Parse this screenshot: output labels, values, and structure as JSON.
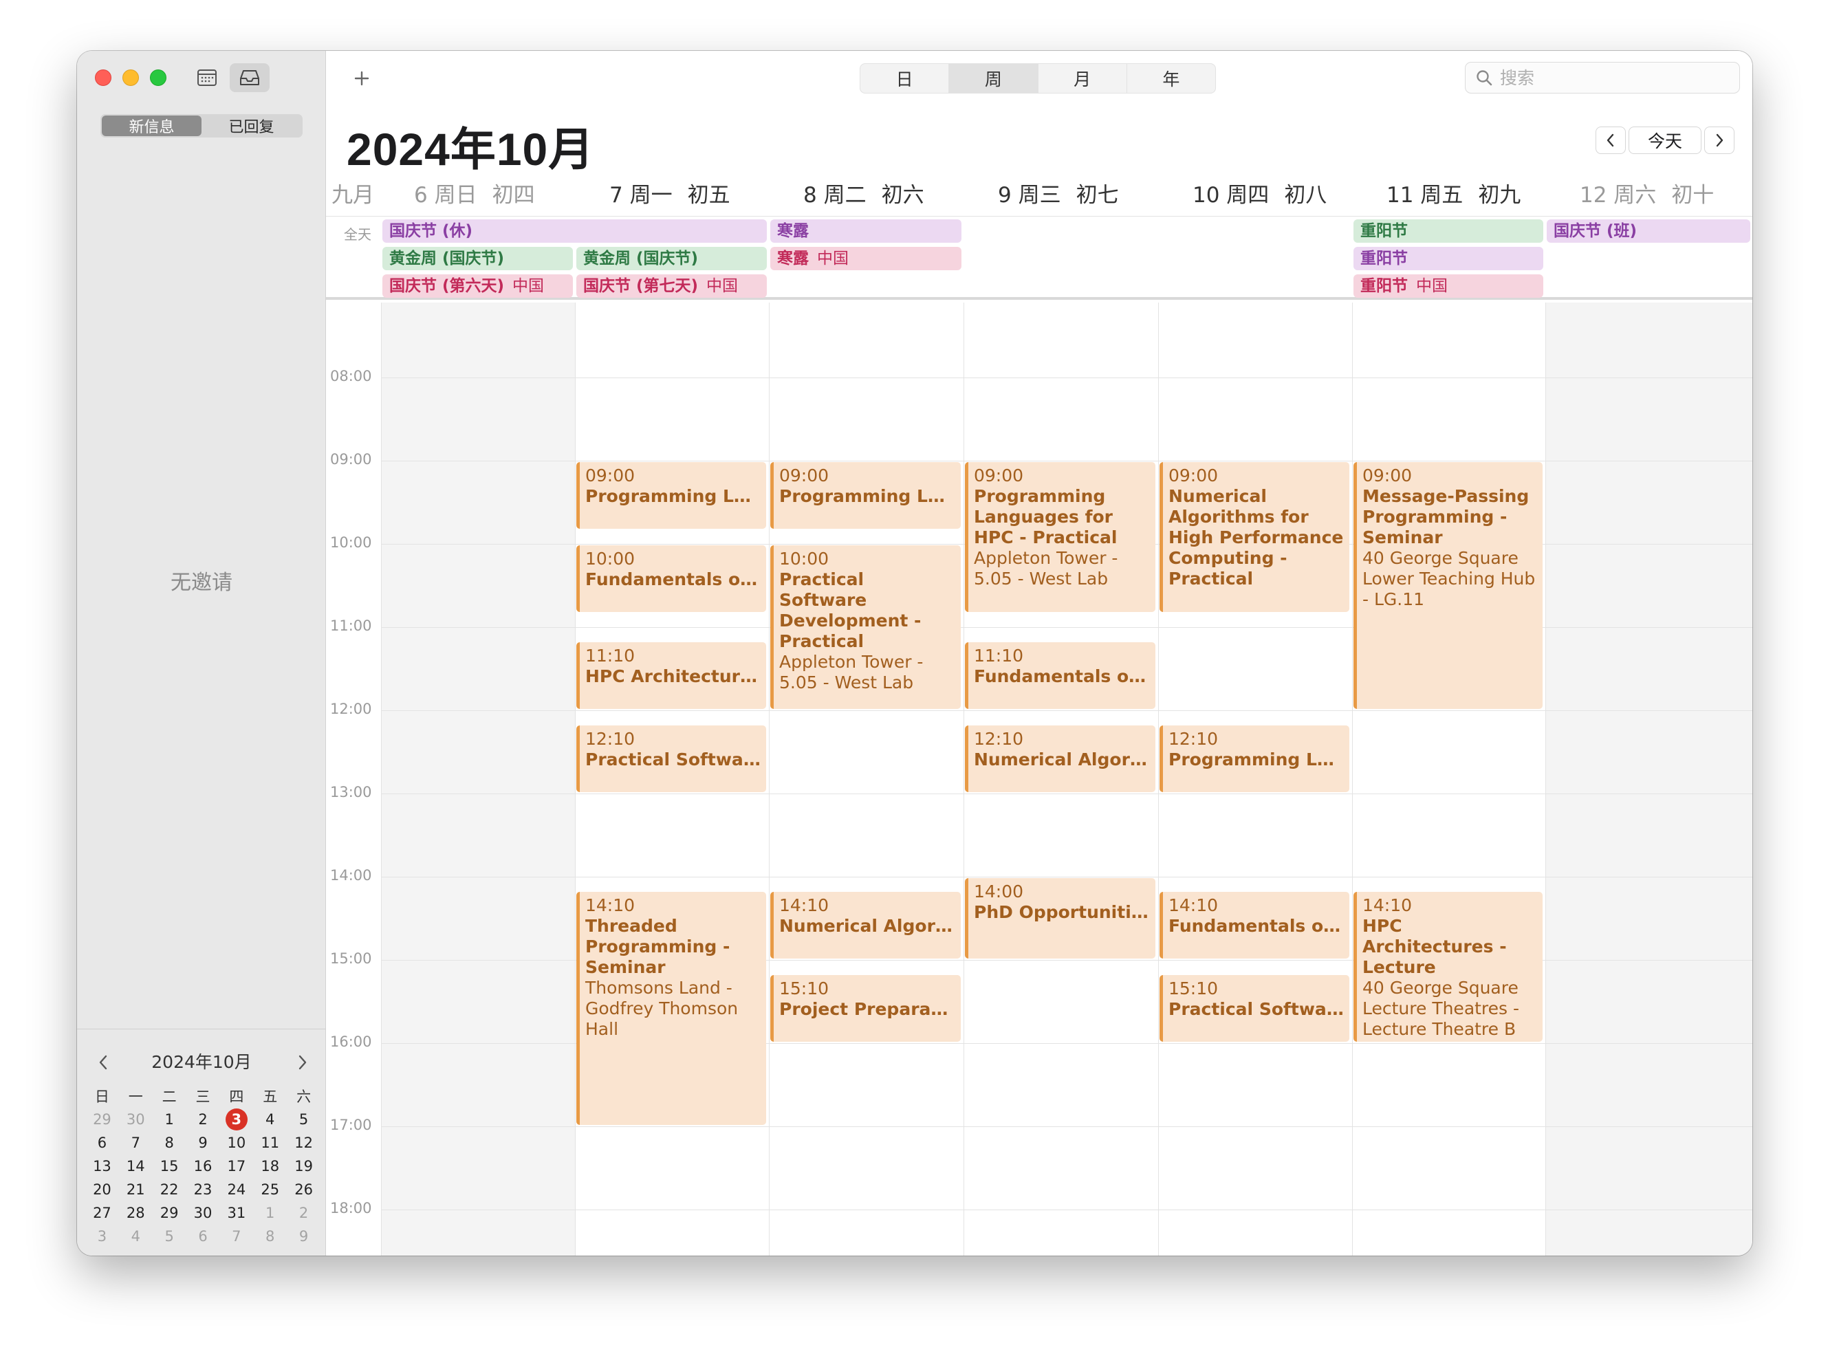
{
  "sidebar": {
    "segments": [
      "新信息",
      "已回复"
    ],
    "empty_text": "无邀请",
    "mini_calendar": {
      "title": "2024年10月",
      "weekdays": [
        "日",
        "一",
        "二",
        "三",
        "四",
        "五",
        "六"
      ],
      "weeks": [
        [
          "29",
          "30",
          "1",
          "2",
          "3",
          "4",
          "5"
        ],
        [
          "6",
          "7",
          "8",
          "9",
          "10",
          "11",
          "12"
        ],
        [
          "13",
          "14",
          "15",
          "16",
          "17",
          "18",
          "19"
        ],
        [
          "20",
          "21",
          "22",
          "23",
          "24",
          "25",
          "26"
        ],
        [
          "27",
          "28",
          "29",
          "30",
          "31",
          "1",
          "2"
        ],
        [
          "3",
          "4",
          "5",
          "6",
          "7",
          "8",
          "9"
        ]
      ],
      "today": "3"
    }
  },
  "toolbar": {
    "add_label": "+",
    "views": [
      "日",
      "周",
      "月",
      "年"
    ],
    "active_view": "周",
    "search_placeholder": "搜索",
    "today_label": "今天"
  },
  "header": {
    "month_title": "2024年10月",
    "month_label": "九月",
    "days": [
      {
        "date": "6 周日",
        "lunar": "初四"
      },
      {
        "date": "7 周一",
        "lunar": "初五"
      },
      {
        "date": "8 周二",
        "lunar": "初六"
      },
      {
        "date": "9 周三",
        "lunar": "初七"
      },
      {
        "date": "10 周四",
        "lunar": "初八"
      },
      {
        "date": "11 周五",
        "lunar": "初九"
      },
      {
        "date": "12 周六",
        "lunar": "初十"
      }
    ]
  },
  "allday_label": "全天",
  "allday_events": [
    {
      "day": 0,
      "span": 2,
      "row": 0,
      "title": "国庆节 (休)",
      "sub": "",
      "color": "purple"
    },
    {
      "day": 0,
      "span": 1,
      "row": 1,
      "title": "黄金周 (国庆节)",
      "sub": "",
      "color": "green"
    },
    {
      "day": 1,
      "span": 1,
      "row": 1,
      "title": "黄金周 (国庆节)",
      "sub": "",
      "color": "green"
    },
    {
      "day": 0,
      "span": 1,
      "row": 2,
      "title": "国庆节 (第六天)",
      "sub": "中国",
      "color": "pink"
    },
    {
      "day": 1,
      "span": 1,
      "row": 2,
      "title": "国庆节 (第七天)",
      "sub": "中国",
      "color": "pink"
    },
    {
      "day": 2,
      "span": 1,
      "row": 0,
      "title": "寒露",
      "sub": "",
      "color": "purple"
    },
    {
      "day": 2,
      "span": 1,
      "row": 1,
      "title": "寒露",
      "sub": "中国",
      "color": "pink"
    },
    {
      "day": 5,
      "span": 1,
      "row": 0,
      "title": "重阳节",
      "sub": "",
      "color": "green"
    },
    {
      "day": 5,
      "span": 1,
      "row": 1,
      "title": "重阳节",
      "sub": "",
      "color": "purple"
    },
    {
      "day": 5,
      "span": 1,
      "row": 2,
      "title": "重阳节",
      "sub": "中国",
      "color": "pink"
    },
    {
      "day": 6,
      "span": 1,
      "row": 0,
      "title": "国庆节 (班)",
      "sub": "",
      "color": "purple"
    }
  ],
  "time_labels": [
    "08:00",
    "09:00",
    "10:00",
    "11:00",
    "12:00",
    "13:00",
    "14:00",
    "15:00",
    "16:00",
    "17:00",
    "18:00"
  ],
  "events": [
    {
      "day": 1,
      "time": "09:00",
      "start": 9.0,
      "end": 9.833,
      "title": "Programming Lang...",
      "location": ""
    },
    {
      "day": 1,
      "time": "10:00",
      "start": 10.0,
      "end": 10.833,
      "title": "Fundamentals of D...",
      "location": ""
    },
    {
      "day": 1,
      "time": "11:10",
      "start": 11.167,
      "end": 12.0,
      "title": "HPC Architectures...",
      "location": ""
    },
    {
      "day": 1,
      "time": "12:10",
      "start": 12.167,
      "end": 13.0,
      "title": "Practical Software...",
      "location": ""
    },
    {
      "day": 1,
      "time": "14:10",
      "start": 14.167,
      "end": 17.0,
      "title": "Threaded Programming - Seminar",
      "location": "Thomsons Land - Godfrey Thomson Hall"
    },
    {
      "day": 2,
      "time": "09:00",
      "start": 9.0,
      "end": 9.833,
      "title": "Programming Lang...",
      "location": ""
    },
    {
      "day": 2,
      "time": "10:00",
      "start": 10.0,
      "end": 12.0,
      "title": "Practical Software Development - Practical",
      "location": "Appleton Tower - 5.05 - West Lab"
    },
    {
      "day": 2,
      "time": "14:10",
      "start": 14.167,
      "end": 15.0,
      "title": "Numerical Algorith...",
      "location": ""
    },
    {
      "day": 2,
      "time": "15:10",
      "start": 15.167,
      "end": 16.0,
      "title": "Project Preparatio...",
      "location": ""
    },
    {
      "day": 3,
      "time": "09:00",
      "start": 9.0,
      "end": 10.833,
      "title": "Programming Languages for HPC - Practical",
      "location": "Appleton Tower - 5.05 - West Lab"
    },
    {
      "day": 3,
      "time": "11:10",
      "start": 11.167,
      "end": 12.0,
      "title": "Fundamentals of D...",
      "location": ""
    },
    {
      "day": 3,
      "time": "12:10",
      "start": 12.167,
      "end": 13.0,
      "title": "Numerical Algorith...",
      "location": ""
    },
    {
      "day": 3,
      "time": "14:00",
      "start": 14.0,
      "end": 15.0,
      "title": "PhD Opportunities with Nick Brown...",
      "location": ""
    },
    {
      "day": 4,
      "time": "09:00",
      "start": 9.0,
      "end": 10.833,
      "title": "Numerical Algorithms for High Performance Computing - Practical",
      "location": ""
    },
    {
      "day": 4,
      "time": "12:10",
      "start": 12.167,
      "end": 13.0,
      "title": "Programming Lang...",
      "location": ""
    },
    {
      "day": 4,
      "time": "14:10",
      "start": 14.167,
      "end": 15.0,
      "title": "Fundamentals of D...",
      "location": ""
    },
    {
      "day": 4,
      "time": "15:10",
      "start": 15.167,
      "end": 16.0,
      "title": "Practical Software...",
      "location": ""
    },
    {
      "day": 5,
      "time": "09:00",
      "start": 9.0,
      "end": 12.0,
      "title": "Message-Passing Programming - Seminar",
      "location": "40 George Square Lower Teaching Hub - LG.11"
    },
    {
      "day": 5,
      "time": "14:10",
      "start": 14.167,
      "end": 16.0,
      "title": "HPC Architectures - Lecture",
      "location": "40 George Square Lecture Theatres - Lecture Theatre B"
    }
  ]
}
